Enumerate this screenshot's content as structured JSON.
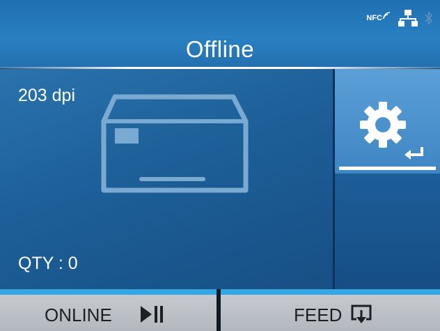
{
  "header": {
    "title": "Offline",
    "status_icons": [
      "nfc-icon",
      "network-icon",
      "bluetooth-icon"
    ],
    "nfc_label": "NFC"
  },
  "main": {
    "resolution": "203 dpi",
    "quantity": "QTY : 0",
    "settings_button": {
      "icon": "gear-icon",
      "secondary_icon": "enter-icon"
    }
  },
  "footer": {
    "online_label": "ONLINE",
    "online_icon": "play-pause-icon",
    "feed_label": "FEED",
    "feed_icon": "feed-icon"
  },
  "colors": {
    "header_blue": "#2a80c2",
    "panel_blue": "#1d5f98",
    "settings_tile": "#4a90cc",
    "accent_cyan": "#33a6e3",
    "footer_button": "#c0c4c9"
  }
}
